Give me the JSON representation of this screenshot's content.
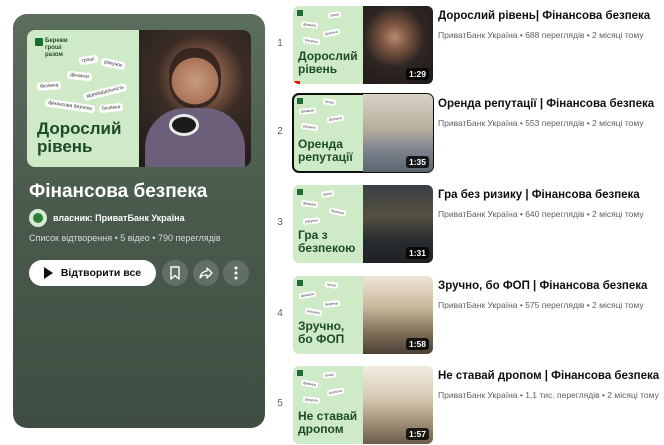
{
  "playlist": {
    "cover": {
      "logo_text": "Бережи гроші разом",
      "tags": [
        "гроші",
        "рахунок",
        "фінанси",
        "безпека",
        "відповідальність",
        "фінансова безпека",
        "безпека"
      ],
      "title_line1": "Дорослий",
      "title_line2": "рівень"
    },
    "title": "Фінансова безпека",
    "owner": "власник: ПриватБанк Україна",
    "meta": "Список відтворення • 5 відео • 790 переглядів",
    "play_all_label": "Відтворити все",
    "icons": {
      "save": "bookmark-icon",
      "share": "share-icon",
      "more": "more-vert-icon"
    }
  },
  "videos": [
    {
      "index": "1",
      "title": "Дорослий рівень| Фінансова безпека",
      "meta": "ПриватБанк Україна • 688 переглядів • 2 місяці тому",
      "thumb_title_line1": "Дорослий",
      "thumb_title_line2": "рівень",
      "duration": "1:29",
      "watched_fraction": 0.05
    },
    {
      "index": "2",
      "title": "Оренда репутації | Фінансова безпека",
      "meta": "ПриватБанк Україна • 553 переглядів • 2 місяці тому",
      "thumb_title_line1": "Оренда",
      "thumb_title_line2": "репутації",
      "duration": "1:35"
    },
    {
      "index": "3",
      "title": "Гра без ризику | Фінансова безпека",
      "meta": "ПриватБанк Україна • 640 переглядів • 2 місяці тому",
      "thumb_title_line1": "Гра з",
      "thumb_title_line2": "безпекою",
      "duration": "1:31"
    },
    {
      "index": "4",
      "title": "Зручно, бо ФОП | Фінансова безпека",
      "meta": "ПриватБанк Україна • 575 переглядів • 2 місяці тому",
      "thumb_title_line1": "Зручно,",
      "thumb_title_line2": "бо ФОП",
      "duration": "1:58"
    },
    {
      "index": "5",
      "title": "Не ставай дропом | Фінансова безпека",
      "meta": "ПриватБанк Україна • 1,1 тис. переглядів • 2 місяці тому",
      "thumb_title_line1": "Не ставай",
      "thumb_title_line2": "дропом",
      "duration": "1:57"
    }
  ],
  "colors": {
    "cover_green": "#cfeac6",
    "title_green": "#1d4a2a",
    "progress_red": "#ff0000"
  }
}
